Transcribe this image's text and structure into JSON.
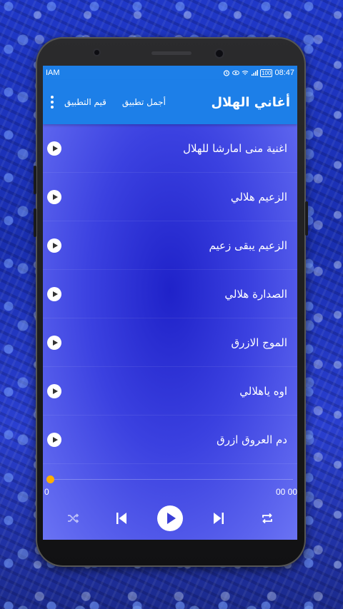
{
  "status": {
    "carrier": "IAM",
    "time": "08:47",
    "battery": "100"
  },
  "appbar": {
    "title": "أغاني الهلال",
    "action_rate": "قيم التطبيق",
    "action_best": "أجمل تطبيق",
    "icons": {
      "menu": "more-vert-icon"
    }
  },
  "songs": [
    {
      "title": "اغنية منى امارشا للهلال"
    },
    {
      "title": "الزعيم هلالي"
    },
    {
      "title": "الزعيم يبقى زعيم"
    },
    {
      "title": "الصدارة هلالي"
    },
    {
      "title": "الموج الازرق"
    },
    {
      "title": "اوه ياهلالي"
    },
    {
      "title": "دم العروق ازرق"
    }
  ],
  "player": {
    "current_time": "0",
    "duration": "00 00",
    "progress": 0,
    "icons": {
      "shuffle": "shuffle-icon",
      "previous": "skip-previous-icon",
      "play": "play-icon",
      "next": "skip-next-icon",
      "repeat": "repeat-icon"
    }
  },
  "colors": {
    "accent": "#1d7fe8",
    "seek_thumb": "#ffae00",
    "list_bg_center": "#1f22c9",
    "list_bg_edge": "#6a73f4"
  }
}
